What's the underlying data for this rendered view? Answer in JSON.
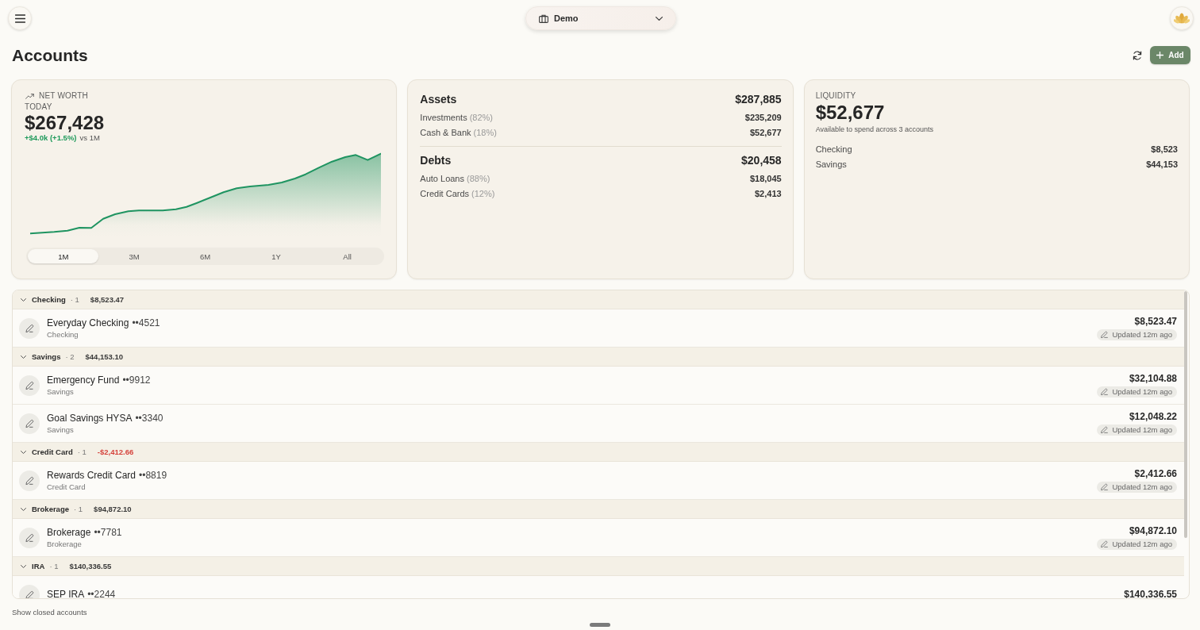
{
  "top_bar": {
    "workspace": "Demo"
  },
  "header": {
    "title": "Accounts",
    "add_button": "Add"
  },
  "net_worth_card": {
    "label": "NET WORTH",
    "period": "TODAY",
    "value": "$267,428",
    "change": "+$4.0k (+1.5%)",
    "change_positive": true,
    "comparison": "vs 1M",
    "ranges": [
      {
        "label": "1M",
        "selected": true
      },
      {
        "label": "3M",
        "selected": false
      },
      {
        "label": "6M",
        "selected": false
      },
      {
        "label": "1Y",
        "selected": false
      },
      {
        "label": "All",
        "selected": false
      }
    ]
  },
  "balance_card": {
    "sections": [
      {
        "title": "Assets",
        "total": "$287,885",
        "items": [
          {
            "label": "Investments",
            "share": "(82%)",
            "amount": "$235,209"
          },
          {
            "label": "Cash & Bank",
            "share": "(18%)",
            "amount": "$52,677"
          }
        ]
      },
      {
        "title": "Debts",
        "total": "$20,458",
        "items": [
          {
            "label": "Auto Loans",
            "share": "(88%)",
            "amount": "$18,045"
          },
          {
            "label": "Credit Cards",
            "share": "(12%)",
            "amount": "$2,413"
          }
        ]
      }
    ]
  },
  "liquidity_card": {
    "label": "LIQUIDITY",
    "value": "$52,677",
    "caption": "Available to spend across 3 accounts",
    "items": [
      {
        "label": "Checking",
        "amount": "$8,523"
      },
      {
        "label": "Savings",
        "amount": "$44,153"
      }
    ]
  },
  "account_groups": [
    {
      "name": "Checking",
      "count": "· 1",
      "total": "$8,523.47",
      "negative": false,
      "expanded": true,
      "accounts": [
        {
          "name": "Everyday Checking",
          "mask": "••4521",
          "type": "Checking",
          "balance": "$8,523.47",
          "status": "Updated 12m ago"
        }
      ]
    },
    {
      "name": "Savings",
      "count": "· 2",
      "total": "$44,153.10",
      "negative": false,
      "expanded": true,
      "accounts": [
        {
          "name": "Emergency Fund",
          "mask": "••9912",
          "type": "Savings",
          "balance": "$32,104.88",
          "status": "Updated 12m ago"
        },
        {
          "name": "Goal Savings HYSA",
          "mask": "••3340",
          "type": "Savings",
          "balance": "$12,048.22",
          "status": "Updated 12m ago"
        }
      ]
    },
    {
      "name": "Credit Card",
      "count": "· 1",
      "total": "-$2,412.66",
      "negative": true,
      "expanded": true,
      "accounts": [
        {
          "name": "Rewards Credit Card",
          "mask": "••8819",
          "type": "Credit Card",
          "balance": "$2,412.66",
          "status": "Updated 12m ago"
        }
      ]
    },
    {
      "name": "Brokerage",
      "count": "· 1",
      "total": "$94,872.10",
      "negative": false,
      "expanded": true,
      "accounts": [
        {
          "name": "Brokerage",
          "mask": "••7781",
          "type": "Brokerage",
          "balance": "$94,872.10",
          "status": "Updated 12m ago"
        }
      ]
    },
    {
      "name": "IRA",
      "count": "· 1",
      "total": "$140,336.55",
      "negative": false,
      "expanded": true,
      "accounts": [
        {
          "name": "SEP IRA",
          "mask": "••2244",
          "balance": "$140,336.55"
        }
      ]
    }
  ],
  "footer": {
    "show_closed": "Show closed accounts"
  }
}
